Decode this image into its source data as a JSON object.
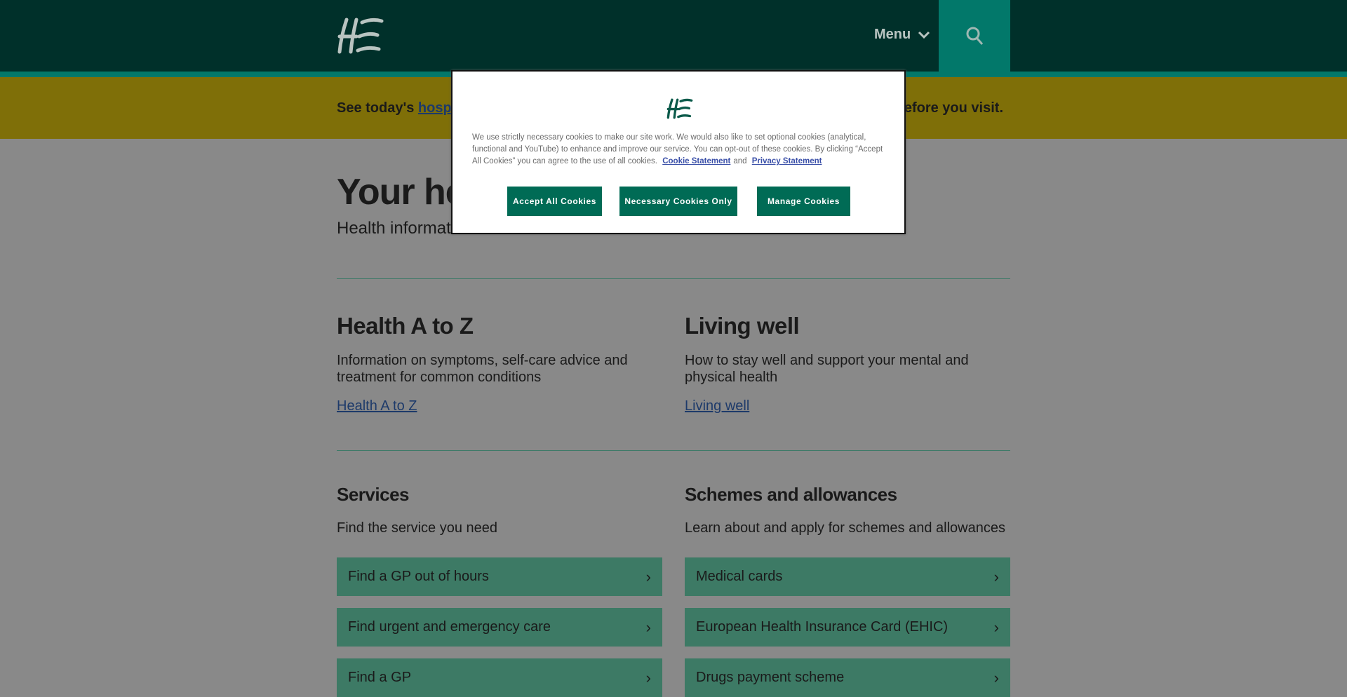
{
  "header": {
    "logo_text": "HSE",
    "menu_label": "Menu",
    "search_icon": "search-icon"
  },
  "alert": {
    "prefix": "See today's ",
    "link": "hospit",
    "suffix": "before you visit."
  },
  "hero": {
    "title": "Your he",
    "subtitle": "Health informat"
  },
  "sections": [
    {
      "heading": "Health A to Z",
      "description": "Information on symptoms, self-care advice and treatment for common conditions",
      "link": "Health A to Z"
    },
    {
      "heading": "Living well",
      "description": "How to stay well and support your mental and physical health",
      "link": "Living well"
    }
  ],
  "services": {
    "heading": "Services",
    "description": "Find the service you need",
    "items": [
      "Find a GP out of hours",
      "Find urgent and emergency care",
      "Find a GP"
    ]
  },
  "schemes": {
    "heading": "Schemes and allowances",
    "description": "Learn about and apply for schemes and allowances",
    "items": [
      "Medical cards",
      "European Health Insurance Card (EHIC)",
      "Drugs payment scheme"
    ]
  },
  "cookie_modal": {
    "logo_text": "HSE",
    "text": "We use strictly necessary cookies to make our site work. We would also like to set optional cookies (analytical, functional and YouTube) to enhance and improve our service. You can opt-out of these cookies. By clicking “Accept All Cookies” you can agree to the use of all cookies.",
    "cookie_link": "Cookie Statement",
    "and": "and",
    "privacy_link": "Privacy Statement",
    "accept": "Accept All Cookies",
    "necessary": "Necessary Cookies Only",
    "manage": "Manage Cookies"
  },
  "colors": {
    "header": "#00302a",
    "accent": "#02786a",
    "button": "#006b55",
    "card": "#3d7a65",
    "alert": "#7f6f08"
  }
}
